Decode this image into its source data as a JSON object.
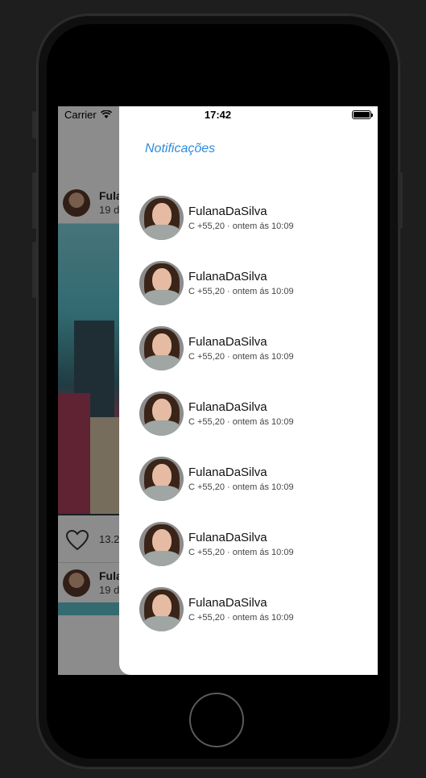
{
  "status_bar": {
    "carrier": "Carrier",
    "time": "17:42"
  },
  "background_feed": {
    "posts": [
      {
        "author": "Fula",
        "date": "19 d"
      },
      {
        "author": "Fula",
        "date": "19 d"
      }
    ],
    "likes": "13.2"
  },
  "drawer": {
    "title": "Notificações",
    "notifications": [
      {
        "name": "FulanaDaSilva",
        "meta": "C +55,20 · ontem ás 10:09"
      },
      {
        "name": "FulanaDaSilva",
        "meta": "C +55,20 · ontem ás 10:09"
      },
      {
        "name": "FulanaDaSilva",
        "meta": "C +55,20 · ontem ás 10:09"
      },
      {
        "name": "FulanaDaSilva",
        "meta": "C +55,20 · ontem ás 10:09"
      },
      {
        "name": "FulanaDaSilva",
        "meta": "C +55,20 · ontem ás 10:09"
      },
      {
        "name": "FulanaDaSilva",
        "meta": "C +55,20 · ontem ás 10:09"
      },
      {
        "name": "FulanaDaSilva",
        "meta": "C +55,20 · ontem ás 10:09"
      }
    ]
  },
  "colors": {
    "accent": "#2d8ce0",
    "photo_sky": "#5cc2cf"
  }
}
